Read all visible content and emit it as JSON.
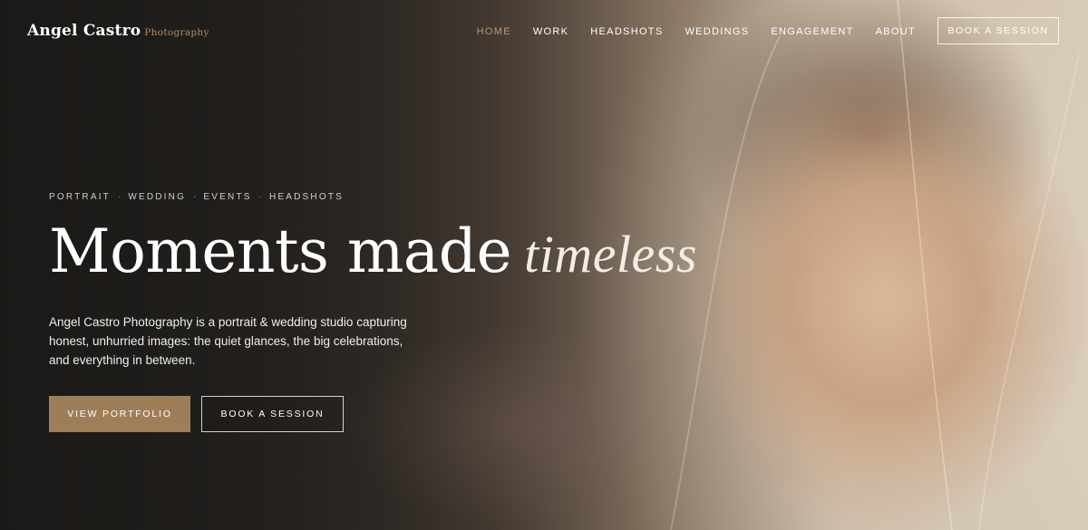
{
  "brand": {
    "name": "Angel Castro",
    "sub": "Photography",
    "accent_color": "#b08d62"
  },
  "nav": {
    "items": [
      "HOME",
      "WORK",
      "HEADSHOTS",
      "WEDDINGS",
      "ENGAGEMENT",
      "ABOUT"
    ],
    "active": "HOME",
    "cta": "BOOK A SESSION"
  },
  "hero": {
    "eyebrow": [
      "PORTRAIT",
      "WEDDING",
      "EVENTS",
      "HEADSHOTS"
    ],
    "eyebrow_separator": "·",
    "title_main": "Moments made",
    "title_accent": "timeless",
    "lead": "Angel Castro Photography is a portrait & wedding studio capturing honest, unhurried images: the quiet glances, the big celebrations, and everything in between.",
    "primary_button": "VIEW PORTFOLIO",
    "secondary_button": "BOOK A SESSION",
    "primary_color": "#9e7e58"
  }
}
